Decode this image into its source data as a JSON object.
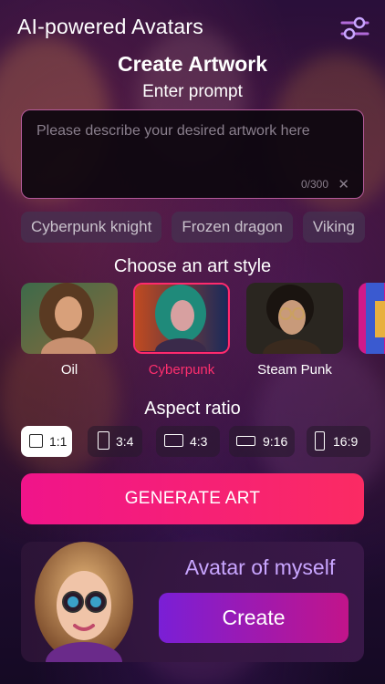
{
  "header": {
    "title": "AI-powered Avatars",
    "settings_icon": "sliders-icon"
  },
  "create": {
    "title": "Create Artwork",
    "prompt_label": "Enter prompt",
    "prompt_placeholder": "Please describe your desired artwork here",
    "char_count": "0/300",
    "clear_icon": "close-icon"
  },
  "suggestions": [
    "Cyberpunk knight",
    "Frozen dragon",
    "Viking"
  ],
  "art_style": {
    "title": "Choose an art style",
    "items": [
      {
        "label": "Oil",
        "selected": false
      },
      {
        "label": "Cyberpunk",
        "selected": true
      },
      {
        "label": "Steam Punk",
        "selected": false
      },
      {
        "label": "",
        "selected": false
      }
    ]
  },
  "aspect": {
    "title": "Aspect ratio",
    "options": [
      {
        "label": "1:1",
        "selected": true
      },
      {
        "label": "3:4",
        "selected": false
      },
      {
        "label": "4:3",
        "selected": false
      },
      {
        "label": "9:16",
        "selected": false
      },
      {
        "label": "16:9",
        "selected": false
      }
    ]
  },
  "generate_label": "GENERATE ART",
  "avatar_card": {
    "title": "Avatar of myself",
    "button_label": "Create"
  },
  "colors": {
    "accent": "#ff2a6d",
    "generate_start": "#f0148a",
    "generate_end": "#fb2b63",
    "avatar_title": "#c9a6ff",
    "create_start": "#7a1fd6",
    "create_end": "#c2148a"
  }
}
